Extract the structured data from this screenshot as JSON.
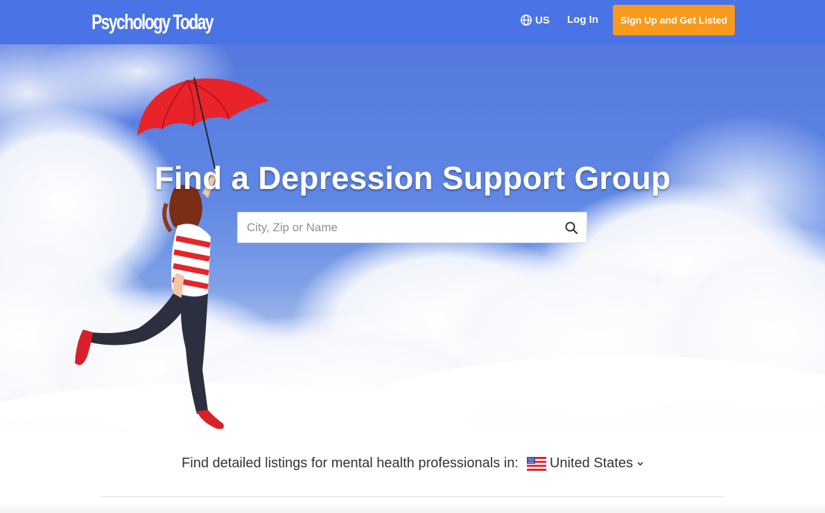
{
  "header": {
    "logo_text": "Psychology Today",
    "locale_label": "US",
    "login_label": "Log In",
    "signup_label": "Sign Up and Get Listed",
    "background_color": "#4a74e5",
    "signup_color": "#f89b1c"
  },
  "hero": {
    "title": "Find a Depression Support Group",
    "search": {
      "placeholder": "City, Zip or Name",
      "value": ""
    },
    "image_description_icon": "umbrella-girl-sky-image"
  },
  "country": {
    "prompt": "Find detailed listings for mental health professionals in:",
    "selected": "United States",
    "flag_icon": "us-flag-icon"
  },
  "icons": {
    "globe": "globe-icon",
    "search": "search-icon",
    "caret": "chevron-down-icon"
  }
}
